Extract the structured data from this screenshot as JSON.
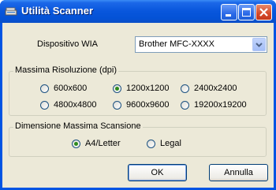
{
  "window": {
    "title": "Utilità Scanner"
  },
  "device": {
    "label": "Dispositivo WIA",
    "selected": "Brother MFC-XXXX"
  },
  "resolution": {
    "title": "Massima Risoluzione (dpi)",
    "options": [
      "600x600",
      "1200x1200",
      "2400x2400",
      "4800x4800",
      "9600x9600",
      "19200x19200"
    ],
    "selected": "1200x1200"
  },
  "size": {
    "title": "Dimensione Massima Scansione",
    "options": [
      "A4/Letter",
      "Legal"
    ],
    "selected": "A4/Letter"
  },
  "buttons": {
    "ok": "OK",
    "cancel": "Annulla"
  }
}
